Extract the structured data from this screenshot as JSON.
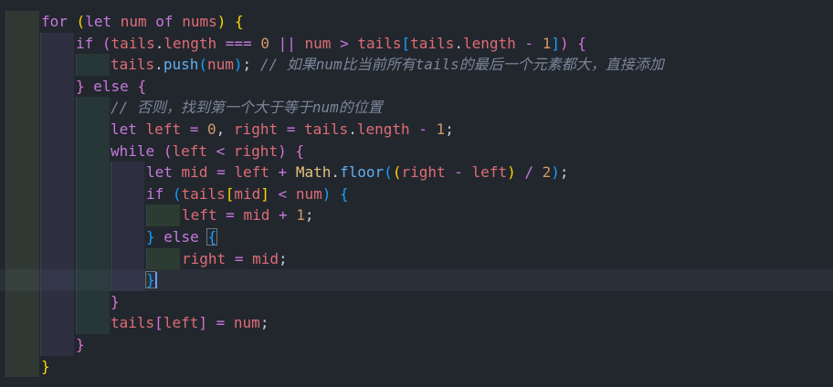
{
  "editor": {
    "theme_colors": {
      "background": "#22272e",
      "keyword": "#c678dd",
      "variable": "#e06c75",
      "number": "#d19a66",
      "function": "#61afef",
      "class": "#e5c07b",
      "comment": "#7a8699",
      "caret": "#6b9cff"
    },
    "lines": [
      [
        "for",
        " ",
        "(",
        "let",
        " ",
        "num",
        " ",
        "of",
        " ",
        "nums",
        ")",
        " ",
        "{"
      ],
      [
        "if",
        " ",
        "(",
        "tails",
        ".",
        "length",
        " ",
        "===",
        " ",
        "0",
        " ",
        "||",
        " ",
        "num",
        " ",
        ">",
        " ",
        "tails",
        "[",
        "tails",
        ".",
        "length",
        " ",
        "-",
        " ",
        "1",
        "]",
        ")",
        " ",
        "{"
      ],
      [
        "tails",
        ".",
        "push",
        "(",
        "num",
        ")",
        ";",
        " ",
        "// 如果num比当前所有tails的最后一个元素都大，直接添加"
      ],
      [
        "}",
        " ",
        "else",
        " ",
        "{"
      ],
      [
        "// 否则，找到第一个大于等于num的位置"
      ],
      [
        "let",
        " ",
        "left",
        " ",
        "=",
        " ",
        "0",
        ",",
        " ",
        "right",
        " ",
        "=",
        " ",
        "tails",
        ".",
        "length",
        " ",
        "-",
        " ",
        "1",
        ";"
      ],
      [
        "while",
        " ",
        "(",
        "left",
        " ",
        "<",
        " ",
        "right",
        ")",
        " ",
        "{"
      ],
      [
        "let",
        " ",
        "mid",
        " ",
        "=",
        " ",
        "left",
        " ",
        "+",
        " ",
        "Math",
        ".",
        "floor",
        "(",
        "(",
        "right",
        " ",
        "-",
        " ",
        "left",
        ")",
        " ",
        "/",
        " ",
        "2",
        ")",
        ";"
      ],
      [
        "if",
        " ",
        "(",
        "tails",
        "[",
        "mid",
        "]",
        " ",
        "<",
        " ",
        "num",
        ")",
        " ",
        "{"
      ],
      [
        "left",
        " ",
        "=",
        " ",
        "mid",
        " ",
        "+",
        " ",
        "1",
        ";"
      ],
      [
        "}",
        " ",
        "else",
        " ",
        "{"
      ],
      [
        "right",
        " ",
        "=",
        " ",
        "mid",
        ";"
      ],
      [
        "}"
      ],
      [
        "}"
      ],
      [
        "tails",
        "[",
        "left",
        "]",
        " ",
        "=",
        " ",
        "num",
        ";"
      ],
      [
        "}"
      ],
      [
        "}"
      ]
    ]
  }
}
